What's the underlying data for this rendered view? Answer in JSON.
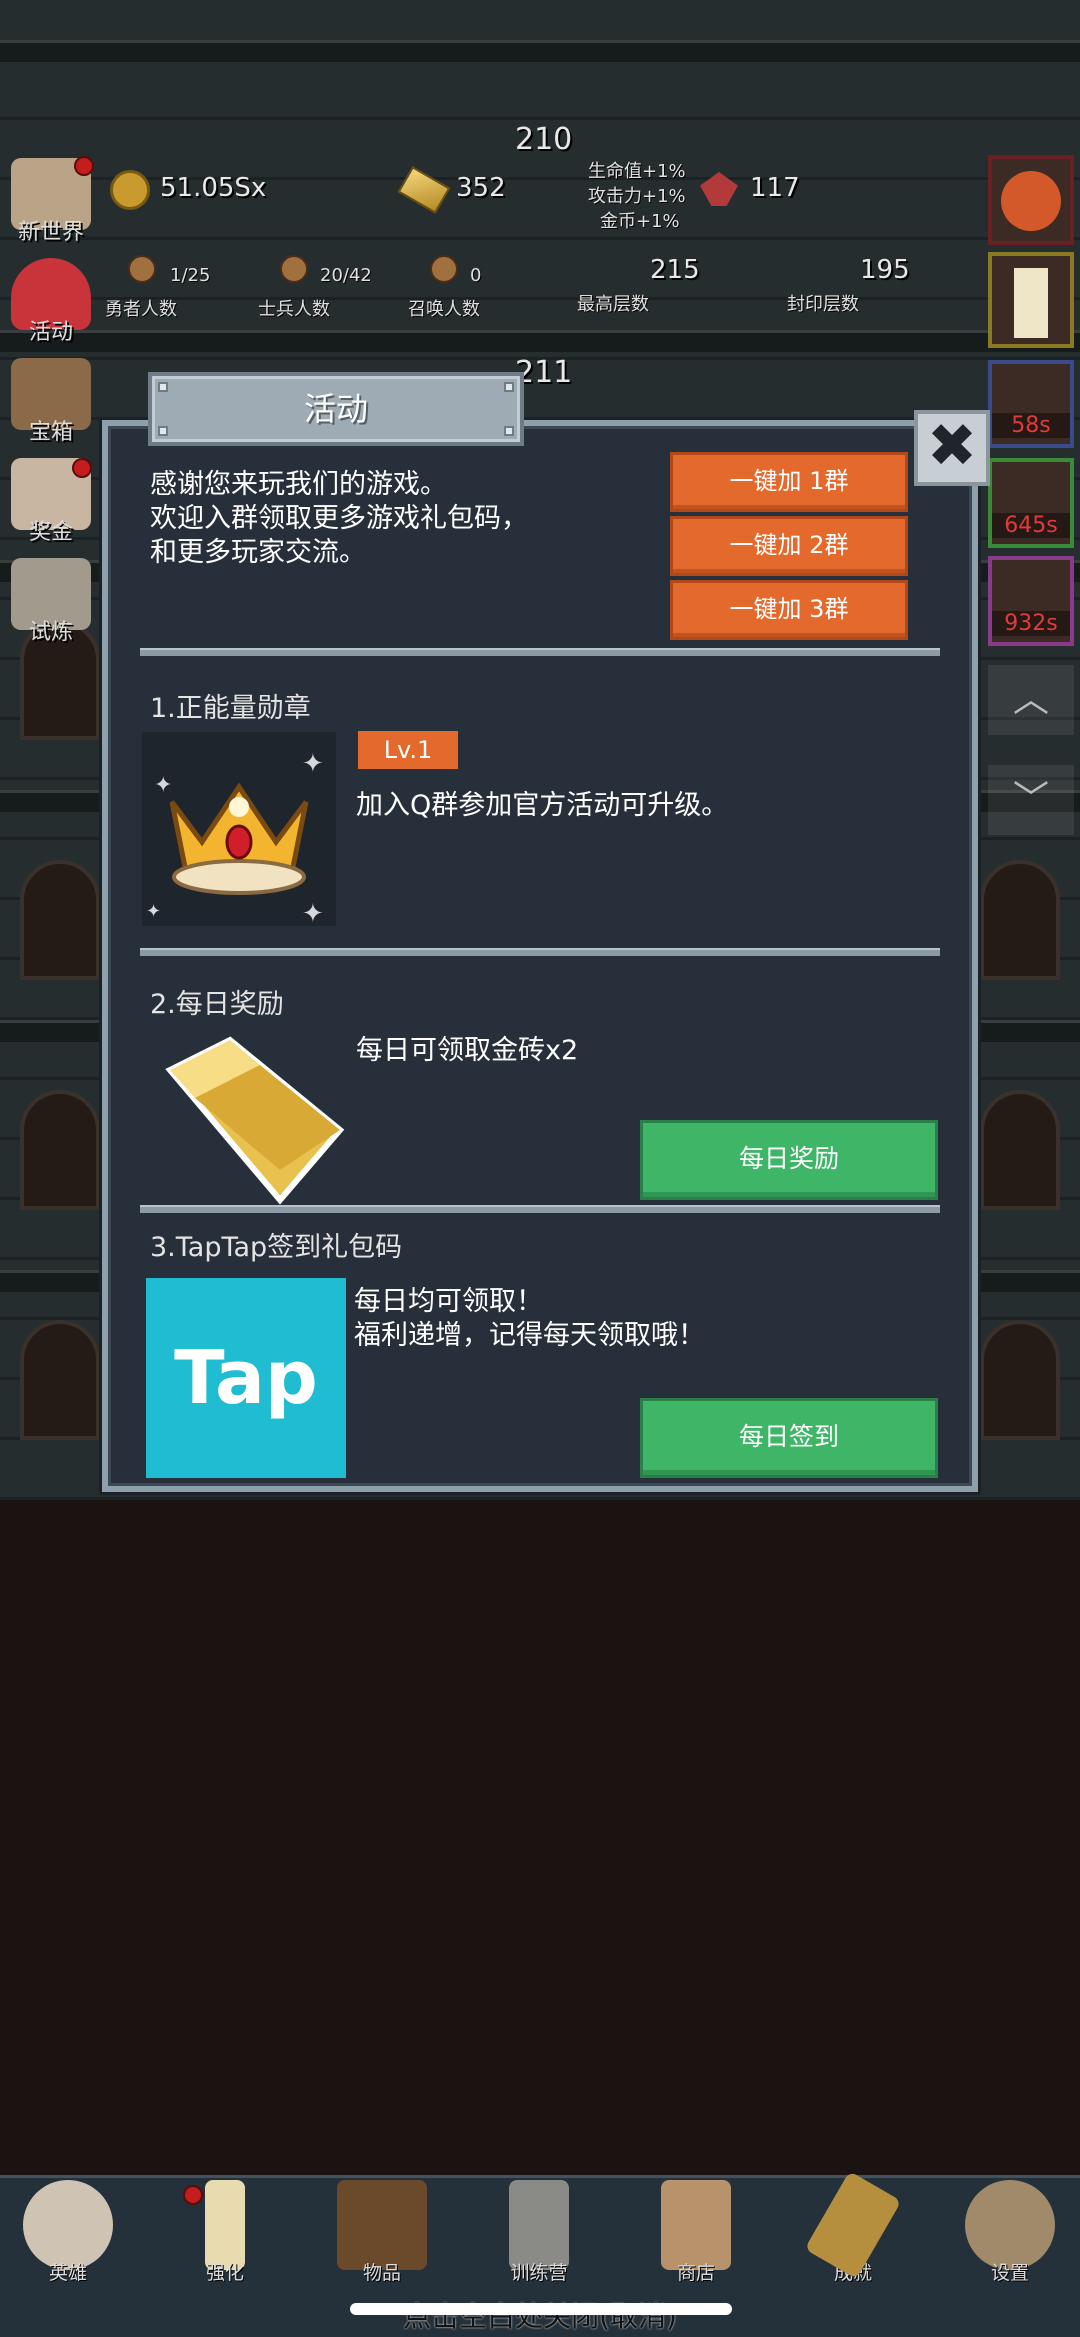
{
  "top": {
    "floor_above": "210",
    "floor_below": "211",
    "gold": "51.05Sx",
    "gold_bars": "352",
    "gems": "117",
    "buff_hp": "生命值+1%",
    "buff_atk": "攻击力+1%",
    "buff_gold": "金币+1%",
    "heroes": "1/25",
    "heroes_label": "勇者人数",
    "soldiers": "20/42",
    "soldiers_label": "士兵人数",
    "summons": "0",
    "summons_label": "召唤人数",
    "max_floor": "215",
    "max_floor_label": "最高层数",
    "seal_floor": "195",
    "seal_floor_label": "封印层数"
  },
  "left_menu": [
    "新世界",
    "活动",
    "宝箱",
    "奖金",
    "试炼"
  ],
  "right_timers": [
    "58s",
    "645s",
    "932s"
  ],
  "modal": {
    "title": "活动",
    "close": "✖",
    "intro_lines": [
      "感谢您来玩我们的游戏。",
      "欢迎入群领取更多游戏礼包码，",
      "和更多玩家交流。"
    ],
    "join_buttons": [
      "一键加 1群",
      "一键加 2群",
      "一键加 3群"
    ],
    "s1_title": "1.正能量勋章",
    "s1_level": "Lv.1",
    "s1_desc": "加入Q群参加官方活动可升级。",
    "s2_title": "2.每日奖励",
    "s2_desc": "每日可领取金砖x2",
    "s2_button": "每日奖励",
    "s3_title": "3.TapTap签到礼包码",
    "s3_logo": "Tap",
    "s3_desc1": "每日均可领取！",
    "s3_desc2": "福利递增，记得每天领取哦！",
    "s3_button": "每日签到"
  },
  "bottom_tabs": [
    "英雄",
    "强化",
    "物品",
    "训练营",
    "商店",
    "成就",
    "设置"
  ],
  "hint": "点击空白处关闭(取消)",
  "colors": {
    "orange": "#e4692d",
    "green": "#3fb567",
    "panel": "#27303a",
    "tap": "#1fbcd2"
  }
}
